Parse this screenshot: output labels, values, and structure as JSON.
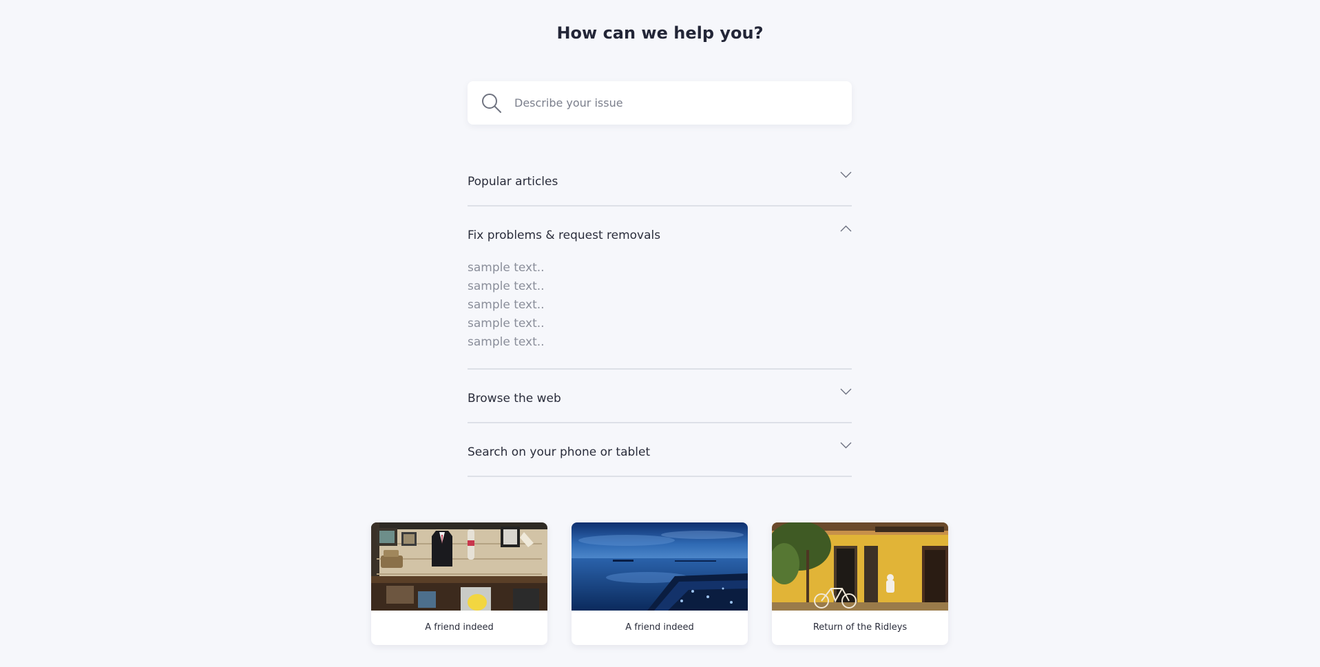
{
  "header": {
    "title": "How can we help you?"
  },
  "search": {
    "placeholder": "Describe your issue",
    "icon": "search-icon"
  },
  "accordion": {
    "sections": [
      {
        "title": "Popular articles",
        "expanded": false,
        "icon": "chevron-down-icon"
      },
      {
        "title": "Fix problems & request removals",
        "expanded": true,
        "icon": "chevron-up-icon",
        "items": [
          "sample text..",
          "sample text..",
          "sample text..",
          "sample text..",
          "sample text.."
        ]
      },
      {
        "title": "Browse the web",
        "expanded": false,
        "icon": "chevron-down-icon"
      },
      {
        "title": "Search on your phone or tablet",
        "expanded": false,
        "icon": "chevron-down-icon"
      }
    ]
  },
  "cards": [
    {
      "title": "A friend indeed",
      "image": "shop-interior-photo"
    },
    {
      "title": "A friend indeed",
      "image": "blue-seashore-photo"
    },
    {
      "title": "Return of the Ridleys",
      "image": "yellow-house-bicycle-photo"
    }
  ],
  "colors": {
    "background": "#f6f7fb",
    "heading": "#232637",
    "muted_text": "#8a8e9a",
    "divider": "#dde0e7",
    "card_bg": "#ffffff"
  }
}
